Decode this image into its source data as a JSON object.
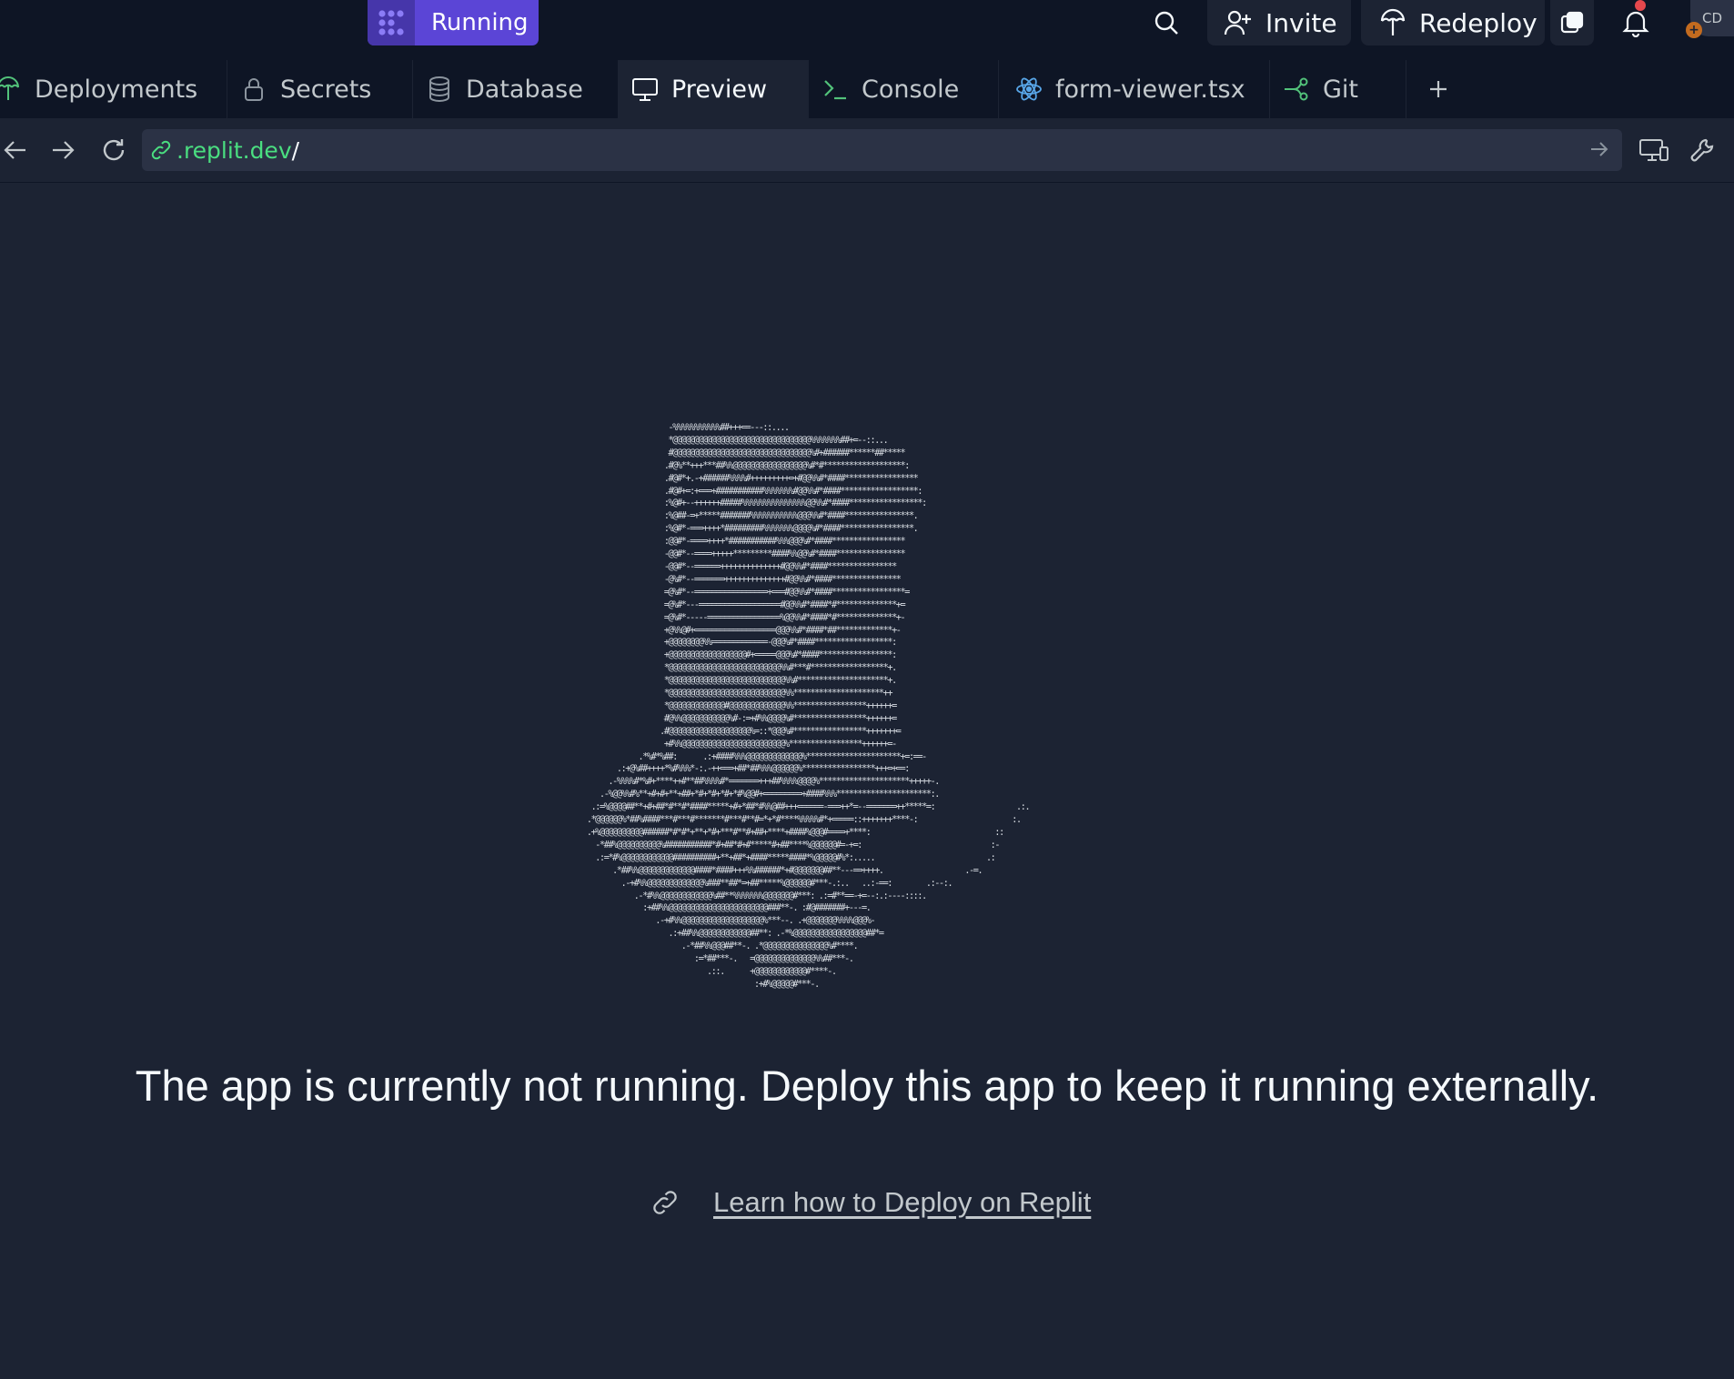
{
  "topbar": {
    "run_label": "Running",
    "invite_label": "Invite",
    "redeploy_label": "Redeploy",
    "avatar_initials": "CD"
  },
  "tabs": [
    {
      "label": "Deployments",
      "icon": "deploy-icon"
    },
    {
      "label": "Secrets",
      "icon": "lock-icon"
    },
    {
      "label": "Database",
      "icon": "database-icon"
    },
    {
      "label": "Preview",
      "icon": "monitor-icon",
      "active": true
    },
    {
      "label": "Console",
      "icon": "terminal-icon"
    },
    {
      "label": "form-viewer.tsx",
      "icon": "react-icon"
    },
    {
      "label": "Git",
      "icon": "git-icon"
    }
  ],
  "address": {
    "domain": ".replit.dev",
    "path": "/"
  },
  "preview": {
    "message": "The app is currently not running. Deploy this app to keep it running externally.",
    "link_label": "Learn how to Deploy on Replit"
  },
  "colors": {
    "accent": "#5b45d6",
    "background": "#1c2333",
    "topbar": "#0e1525",
    "url_green": "#4ade80",
    "notification": "#e5484d"
  }
}
